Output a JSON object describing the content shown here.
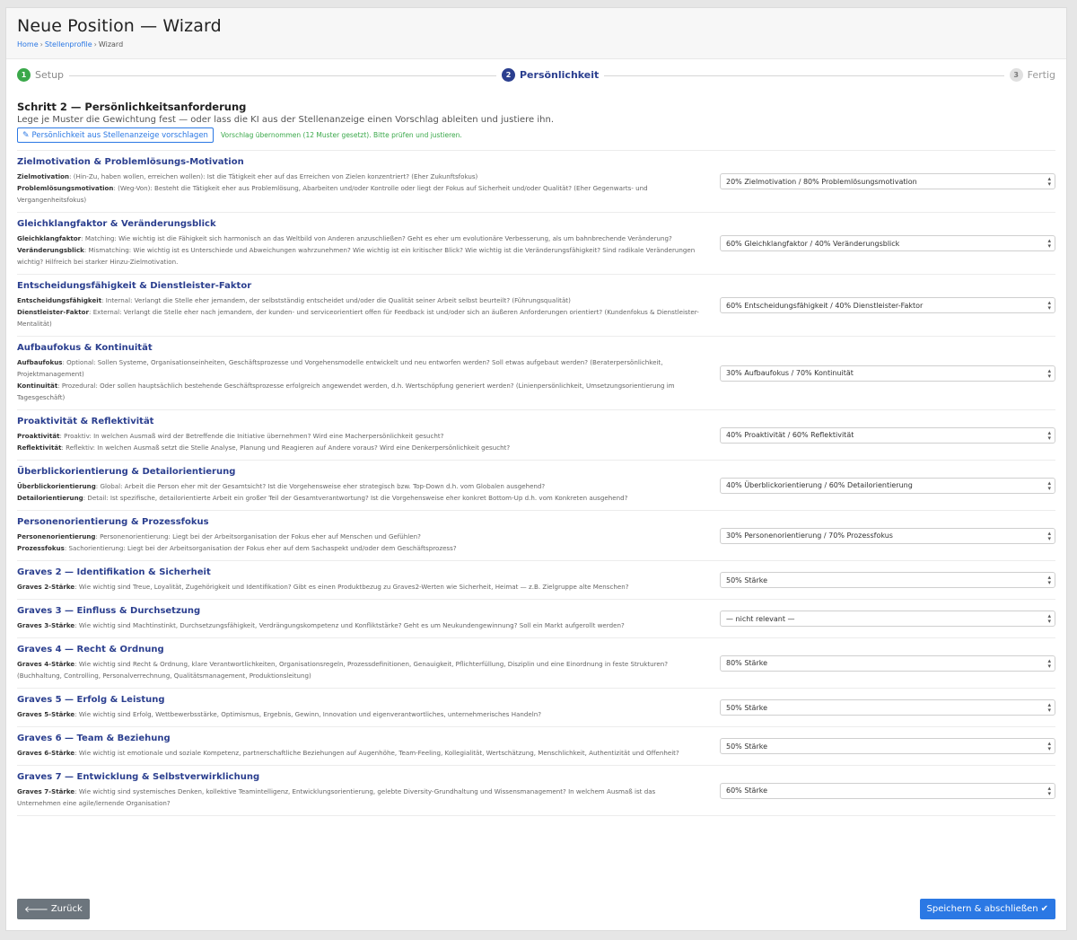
{
  "header": {
    "title": "Neue Position — Wizard",
    "breadcrumb": {
      "home": "Home",
      "profiles": "Stellenprofile",
      "current": "Wizard",
      "sep": "›"
    }
  },
  "stepper": {
    "steps": [
      {
        "num": "1",
        "label": "Setup",
        "state": "done"
      },
      {
        "num": "2",
        "label": "Persönlichkeit",
        "state": "active"
      },
      {
        "num": "3",
        "label": "Fertig",
        "state": "todo"
      }
    ]
  },
  "intro": {
    "title": "Schritt 2 — Persönlichkeitsanforderung",
    "desc": "Lege je Muster die Gewichtung fest — oder lass die KI aus der Stellenanzeige einen Vorschlag ableiten und justiere ihn.",
    "suggest_label": "Persönlichkeit aus Stellenanzeige vorschlagen",
    "suggest_icon": "pencil-icon",
    "suggest_msg": "Vorschlag übernommen (12 Muster gesetzt). Bitte prüfen und justieren."
  },
  "rows": [
    {
      "title": "Zielmotivation & Problemlösungs-Motivation",
      "lines": [
        {
          "term": "Zielmotivation",
          "text": ": (Hin-Zu, haben wollen, erreichen wollen): Ist die Tätigkeit eher auf das Erreichen von Zielen konzentriert? (Eher Zukunftsfokus)"
        },
        {
          "term": "Problemlösungsmotivation",
          "text": ": (Weg-Von): Besteht die Tätigkeit eher aus Problemlösung, Abarbeiten und/oder Kontrolle oder liegt der Fokus auf Sicherheit und/oder Qualität? (Eher Gegenwarts- und Vergangenheitsfokus)"
        }
      ],
      "select": "20% Zielmotivation / 80% Problemlösungsmotivation"
    },
    {
      "title": "Gleichklangfaktor & Veränderungsblick",
      "lines": [
        {
          "term": "Gleichklangfaktor",
          "text": ": Matching: Wie wichtig ist die Fähigkeit sich harmonisch an das Weltbild von Anderen anzuschließen? Geht es eher um evolutionäre Verbesserung, als um bahnbrechende Veränderung?"
        },
        {
          "term": "Veränderungsblick",
          "text": ": Mismatching: Wie wichtig ist es Unterschiede und Abweichungen wahrzunehmen? Wie wichtig ist ein kritischer Blick? Wie wichtig ist die Veränderungsfähigkeit? Sind radikale Veränderungen wichtig? Hilfreich bei starker Hinzu-Zielmotivation."
        }
      ],
      "select": "60% Gleichklangfaktor / 40% Veränderungsblick"
    },
    {
      "title": "Entscheidungsfähigkeit & Dienstleister-Faktor",
      "lines": [
        {
          "term": "Entscheidungsfähigkeit",
          "text": ": Internal: Verlangt die Stelle eher jemandem, der selbstständig entscheidet und/oder die Qualität seiner Arbeit selbst beurteilt? (Führungsqualität)"
        },
        {
          "term": "Dienstleister-Faktor",
          "text": ": External: Verlangt die Stelle eher nach jemandem, der kunden- und serviceorientiert offen für Feedback ist und/oder sich an äußeren Anforderungen orientiert? (Kundenfokus & Dienstleister-Mentalität)"
        }
      ],
      "select": "60% Entscheidungsfähigkeit / 40% Dienstleister-Faktor"
    },
    {
      "title": "Aufbaufokus & Kontinuität",
      "lines": [
        {
          "term": "Aufbaufokus",
          "text": ": Optional: Sollen Systeme, Organisationseinheiten, Geschäftsprozesse und Vorgehensmodelle entwickelt und neu entworfen werden? Soll etwas aufgebaut werden? (Beraterpersönlichkeit, Projektmanagement)"
        },
        {
          "term": "Kontinuität",
          "text": ": Prozedural: Oder sollen hauptsächlich bestehende Geschäftsprozesse erfolgreich angewendet werden, d.h. Wertschöpfung generiert werden? (Linienpersönlichkeit, Umsetzungsorientierung im Tagesgeschäft)"
        }
      ],
      "select": "30% Aufbaufokus / 70% Kontinuität"
    },
    {
      "title": "Proaktivität & Reflektivität",
      "lines": [
        {
          "term": "Proaktivität",
          "text": ": Proaktiv: In welchen Ausmaß wird der Betreffende die Initiative übernehmen? Wird eine Macherpersönlichkeit gesucht?"
        },
        {
          "term": "Reflektivität",
          "text": ": Reflektiv: In welchen Ausmaß setzt die Stelle Analyse, Planung und Reagieren auf Andere voraus? Wird eine Denkerpersönlichkeit gesucht?"
        }
      ],
      "select": "40% Proaktivität / 60% Reflektivität"
    },
    {
      "title": "Überblickorientierung & Detailorientierung",
      "lines": [
        {
          "term": "Überblickorientierung",
          "text": ": Global: Arbeit die Person eher mit der Gesamtsicht? Ist die Vorgehensweise eher strategisch bzw. Top-Down d.h. vom Globalen ausgehend?"
        },
        {
          "term": "Detailorientierung",
          "text": ": Detail: Ist spezifische, detailorientierte Arbeit ein großer Teil der Gesamtverantwortung? Ist die Vorgehensweise eher konkret Bottom-Up d.h. vom Konkreten ausgehend?"
        }
      ],
      "select": "40% Überblickorientierung / 60% Detailorientierung"
    },
    {
      "title": "Personenorientierung & Prozessfokus",
      "lines": [
        {
          "term": "Personenorientierung",
          "text": ": Personenorientierung: Liegt bei der Arbeitsorganisation der Fokus eher auf Menschen und Gefühlen?"
        },
        {
          "term": "Prozessfokus",
          "text": ": Sachorientierung: Liegt bei der Arbeitsorganisation der Fokus eher auf dem Sachaspekt und/oder dem Geschäftsprozess?"
        }
      ],
      "select": "30% Personenorientierung / 70% Prozessfokus"
    },
    {
      "title": "Graves 2 — Identifikation & Sicherheit",
      "lines": [
        {
          "term": "Graves 2-Stärke",
          "text": ": Wie wichtig sind Treue, Loyalität, Zugehörigkeit und Identifikation? Gibt es einen Produktbezug zu Graves2-Werten wie Sicherheit, Heimat — z.B. Zielgruppe alte Menschen?"
        }
      ],
      "select": "50% Stärke"
    },
    {
      "title": "Graves 3 — Einfluss & Durchsetzung",
      "lines": [
        {
          "term": "Graves 3-Stärke",
          "text": ": Wie wichtig sind Machtinstinkt, Durchsetzungsfähigkeit, Verdrängungskompetenz und Konfliktstärke? Geht es um Neukundengewinnung? Soll ein Markt aufgerollt werden?"
        }
      ],
      "select": "— nicht relevant —"
    },
    {
      "title": "Graves 4 — Recht & Ordnung",
      "lines": [
        {
          "term": "Graves 4-Stärke",
          "text": ": Wie wichtig sind Recht & Ordnung, klare Verantwortlichkeiten, Organisationsregeln, Prozessdefinitionen, Genauigkeit, Pflichterfüllung, Disziplin und eine Einordnung in feste Strukturen? (Buchhaltung, Controlling, Personalverrechnung, Qualitätsmanagement, Produktionsleitung)"
        }
      ],
      "select": "80% Stärke"
    },
    {
      "title": "Graves 5 — Erfolg & Leistung",
      "lines": [
        {
          "term": "Graves 5-Stärke",
          "text": ": Wie wichtig sind Erfolg, Wettbewerbsstärke, Optimismus, Ergebnis, Gewinn, Innovation und eigenverantwortliches, unternehmerisches Handeln?"
        }
      ],
      "select": "50% Stärke"
    },
    {
      "title": "Graves 6 — Team & Beziehung",
      "lines": [
        {
          "term": "Graves 6-Stärke",
          "text": ": Wie wichtig ist emotionale und soziale Kompetenz, partnerschaftliche Beziehungen auf Augenhöhe, Team-Feeling, Kollegialität, Wertschätzung, Menschlichkeit, Authentizität und Offenheit?"
        }
      ],
      "select": "50% Stärke"
    },
    {
      "title": "Graves 7 — Entwicklung & Selbstverwirklichung",
      "lines": [
        {
          "term": "Graves 7-Stärke",
          "text": ": Wie wichtig sind systemisches Denken, kollektive Teamintelligenz, Entwicklungsorientierung, gelebte Diversity-Grundhaltung und Wissensmanagement? In welchem Ausmaß ist das Unternehmen eine agile/lernende Organisation?"
        }
      ],
      "select": "60% Stärke"
    }
  ],
  "footer": {
    "back_label": "Zurück",
    "back_icon": "arrow-left-icon",
    "save_label": "Speichern & abschließen",
    "save_icon": "check-icon"
  },
  "colors": {
    "accent": "#2b78e4",
    "heading": "#2b3f8f",
    "success": "#3aa84a",
    "secondary": "#6c757d"
  }
}
